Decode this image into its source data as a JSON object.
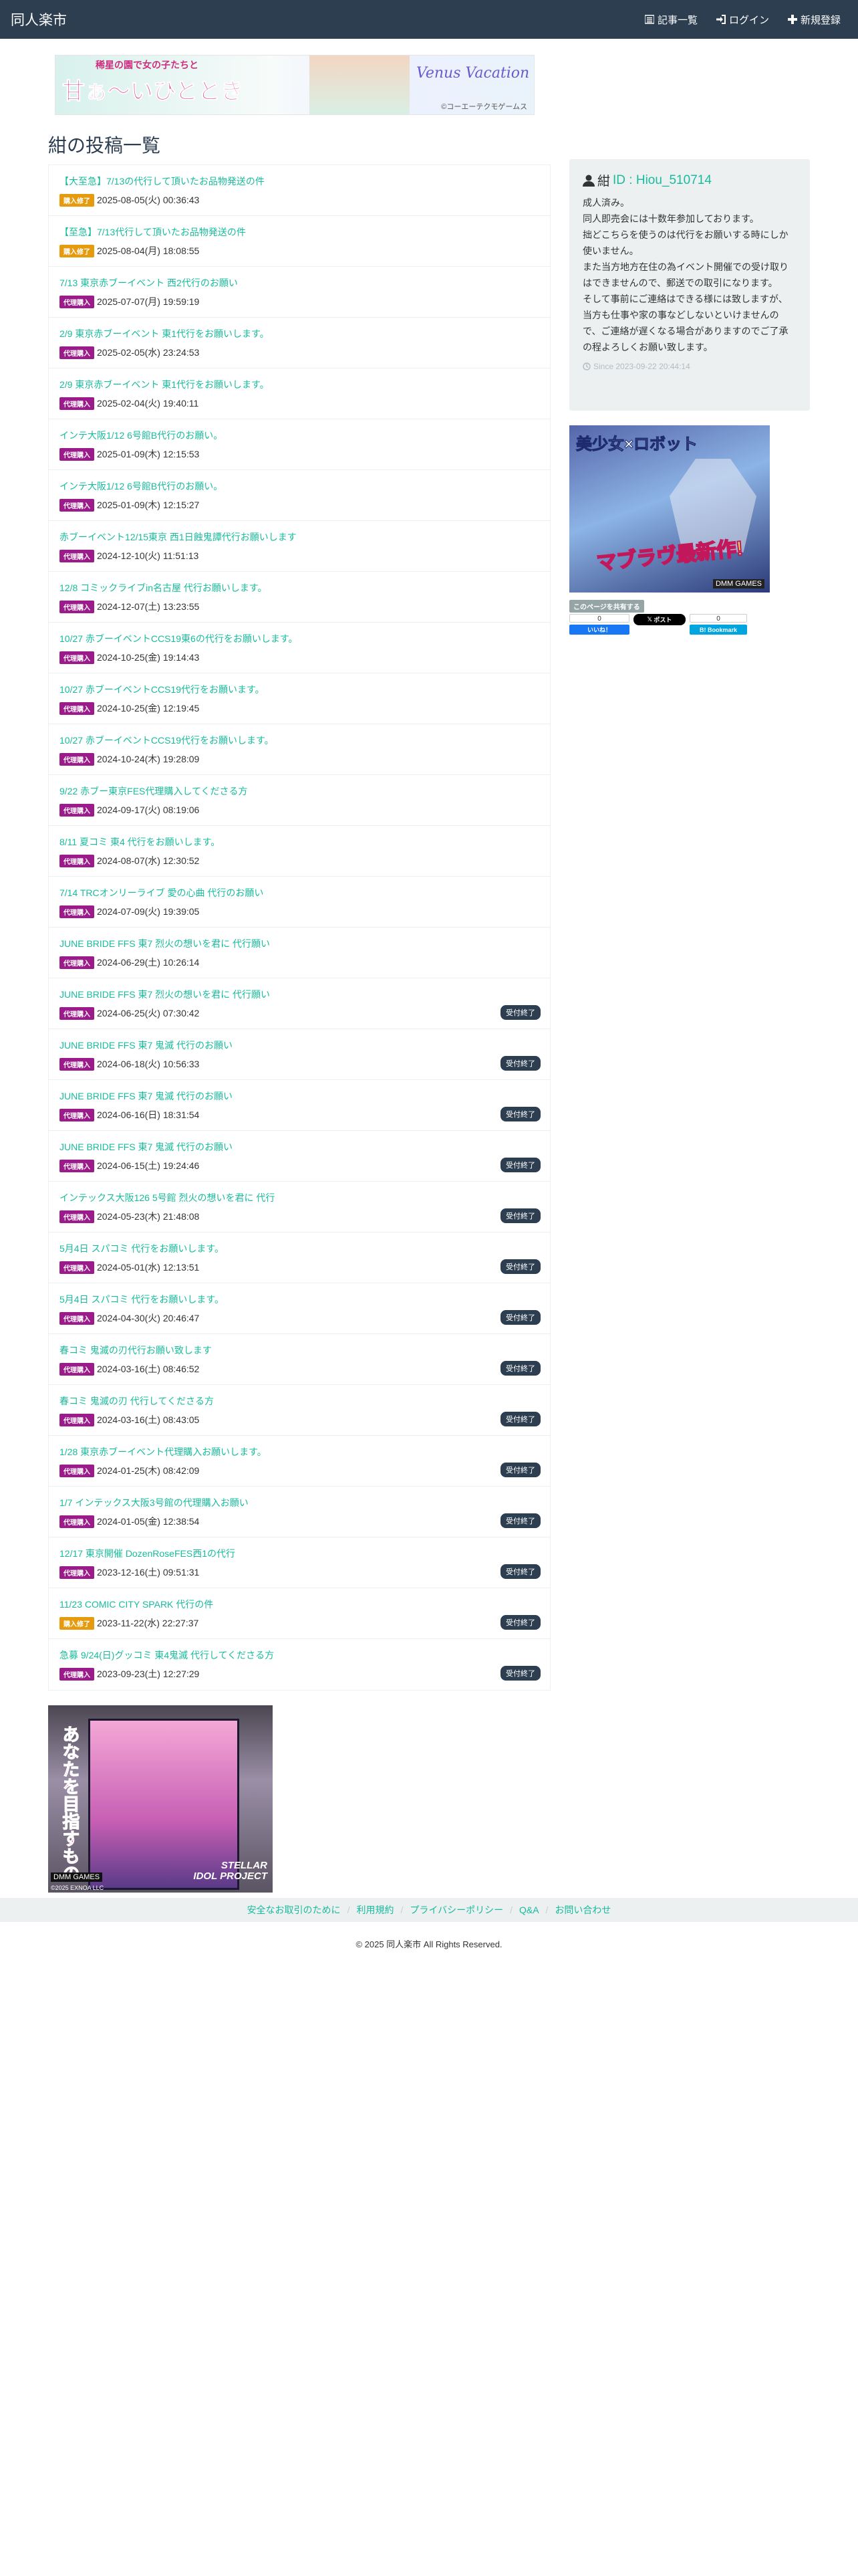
{
  "navbar": {
    "brand": "同人楽市",
    "links": [
      {
        "label": "記事一覧",
        "icon": "list-icon"
      },
      {
        "label": "ログイン",
        "icon": "login-icon"
      },
      {
        "label": "新規登録",
        "icon": "plus-icon"
      }
    ]
  },
  "top_banner": {
    "main_text": "甘ぁ～いひととき",
    "sub_text": "稀星の園で女の子たちと",
    "logo": "Venus Vacation",
    "credit": "©コーエーテクモゲームス"
  },
  "page_title": "紺の投稿一覧",
  "posts": [
    {
      "title": "【大至急】7/13の代行して頂いたお品物発送の件",
      "badge": "購入修了",
      "badge_type": "buy",
      "date": "2025-08-05(火) 00:36:43",
      "status": ""
    },
    {
      "title": "【至急】7/13代行して頂いたお品物発送の件",
      "badge": "購入修了",
      "badge_type": "buy",
      "date": "2025-08-04(月) 18:08:55",
      "status": ""
    },
    {
      "title": "7/13 東京赤ブーイベント 西2代行のお願い",
      "badge": "代理購入",
      "badge_type": "proxy",
      "date": "2025-07-07(月) 19:59:19",
      "status": ""
    },
    {
      "title": "2/9 東京赤ブーイベント 東1代行をお願いします。",
      "badge": "代理購入",
      "badge_type": "proxy",
      "date": "2025-02-05(水) 23:24:53",
      "status": ""
    },
    {
      "title": "2/9 東京赤ブーイベント 東1代行をお願いします。",
      "badge": "代理購入",
      "badge_type": "proxy",
      "date": "2025-02-04(火) 19:40:11",
      "status": ""
    },
    {
      "title": "インテ大阪1/12 6号館B代行のお願い。",
      "badge": "代理購入",
      "badge_type": "proxy",
      "date": "2025-01-09(木) 12:15:53",
      "status": ""
    },
    {
      "title": "インテ大阪1/12 6号館B代行のお願い。",
      "badge": "代理購入",
      "badge_type": "proxy",
      "date": "2025-01-09(木) 12:15:27",
      "status": ""
    },
    {
      "title": "赤ブーイベント12/15東京 西1日蝕鬼譚代行お願いします",
      "badge": "代理購入",
      "badge_type": "proxy",
      "date": "2024-12-10(火) 11:51:13",
      "status": ""
    },
    {
      "title": "12/8 コミックライブin名古屋 代行お願いします。",
      "badge": "代理購入",
      "badge_type": "proxy",
      "date": "2024-12-07(土) 13:23:55",
      "status": ""
    },
    {
      "title": "10/27 赤ブーイベントCCS19東6の代行をお願いします。",
      "badge": "代理購入",
      "badge_type": "proxy",
      "date": "2024-10-25(金) 19:14:43",
      "status": ""
    },
    {
      "title": "10/27 赤ブーイベントCCS19代行をお願います。",
      "badge": "代理購入",
      "badge_type": "proxy",
      "date": "2024-10-25(金) 12:19:45",
      "status": ""
    },
    {
      "title": "10/27 赤ブーイベントCCS19代行をお願いします。",
      "badge": "代理購入",
      "badge_type": "proxy",
      "date": "2024-10-24(木) 19:28:09",
      "status": ""
    },
    {
      "title": "9/22 赤ブー東京FES代理購入してくださる方",
      "badge": "代理購入",
      "badge_type": "proxy",
      "date": "2024-09-17(火) 08:19:06",
      "status": ""
    },
    {
      "title": "8/11 夏コミ 東4 代行をお願いします。",
      "badge": "代理購入",
      "badge_type": "proxy",
      "date": "2024-08-07(水) 12:30:52",
      "status": ""
    },
    {
      "title": "7/14 TRCオンリーライブ 愛の心曲 代行のお願い",
      "badge": "代理購入",
      "badge_type": "proxy",
      "date": "2024-07-09(火) 19:39:05",
      "status": ""
    },
    {
      "title": "JUNE BRIDE FFS 東7 烈火の想いを君に 代行願い",
      "badge": "代理購入",
      "badge_type": "proxy",
      "date": "2024-06-29(土) 10:26:14",
      "status": ""
    },
    {
      "title": "JUNE BRIDE FFS 東7 烈火の想いを君に 代行願い",
      "badge": "代理購入",
      "badge_type": "proxy",
      "date": "2024-06-25(火) 07:30:42",
      "status": "受付終了"
    },
    {
      "title": "JUNE BRIDE FFS 東7 鬼滅 代行のお願い",
      "badge": "代理購入",
      "badge_type": "proxy",
      "date": "2024-06-18(火) 10:56:33",
      "status": "受付終了"
    },
    {
      "title": "JUNE BRIDE FFS 東7 鬼滅 代行のお願い",
      "badge": "代理購入",
      "badge_type": "proxy",
      "date": "2024-06-16(日) 18:31:54",
      "status": "受付終了"
    },
    {
      "title": "JUNE BRIDE FFS 東7 鬼滅 代行のお願い",
      "badge": "代理購入",
      "badge_type": "proxy",
      "date": "2024-06-15(土) 19:24:46",
      "status": "受付終了"
    },
    {
      "title": "インテックス大阪126 5号館 烈火の想いを君に 代行",
      "badge": "代理購入",
      "badge_type": "proxy",
      "date": "2024-05-23(木) 21:48:08",
      "status": "受付終了"
    },
    {
      "title": "5月4日 スパコミ 代行をお願いします。",
      "badge": "代理購入",
      "badge_type": "proxy",
      "date": "2024-05-01(水) 12:13:51",
      "status": "受付終了"
    },
    {
      "title": "5月4日 スパコミ 代行をお願いします。",
      "badge": "代理購入",
      "badge_type": "proxy",
      "date": "2024-04-30(火) 20:46:47",
      "status": "受付終了"
    },
    {
      "title": "春コミ 鬼滅の刃代行お願い致します",
      "badge": "代理購入",
      "badge_type": "proxy",
      "date": "2024-03-16(土) 08:46:52",
      "status": "受付終了"
    },
    {
      "title": "春コミ 鬼滅の刃 代行してくださる方",
      "badge": "代理購入",
      "badge_type": "proxy",
      "date": "2024-03-16(土) 08:43:05",
      "status": "受付終了"
    },
    {
      "title": "1/28 東京赤ブーイベント代理購入お願いします。",
      "badge": "代理購入",
      "badge_type": "proxy",
      "date": "2024-01-25(木) 08:42:09",
      "status": "受付終了"
    },
    {
      "title": "1/7 インテックス大阪3号館の代理購入お願い",
      "badge": "代理購入",
      "badge_type": "proxy",
      "date": "2024-01-05(金) 12:38:54",
      "status": "受付終了"
    },
    {
      "title": "12/17 東京開催 DozenRoseFES西1の代行",
      "badge": "代理購入",
      "badge_type": "proxy",
      "date": "2023-12-16(土) 09:51:31",
      "status": "受付終了"
    },
    {
      "title": "11/23 COMIC CITY SPARK 代行の件",
      "badge": "購入修了",
      "badge_type": "buy",
      "date": "2023-11-22(水) 22:27:37",
      "status": "受付終了"
    },
    {
      "title": "急募 9/24(日)グッコミ 東4鬼滅 代行してくださる方",
      "badge": "代理購入",
      "badge_type": "proxy",
      "date": "2023-09-23(土) 12:27:29",
      "status": "受付終了"
    }
  ],
  "profile": {
    "name": "紺",
    "id": "ID : Hiou_510714",
    "bio": "成人済み。\n同人即売会には十数年参加しております。\n拙どこちらを使うのは代行をお願いする時にしか使いません。\nまた当方地方在住の為イベント開催での受け取りはできませんので、郵送での取引になります。\nそして事前にご連絡はできる様には致しますが、当方も仕事や家の事などしないといけませんので、ご連絡が遅くなる場合がありますのでご了承の程よろしくお願い致します。",
    "since": "Since 2023-09-22 20:44:14"
  },
  "side_ad": {
    "title": "美少女×ロボット",
    "slogan": "マブラヴ最新作!",
    "maker": "DMM GAMES"
  },
  "share": {
    "label": "このページを共有する",
    "fb_count": "0",
    "fb_label": "いいね！",
    "x_label": "ポスト",
    "hatena_count": "0",
    "hatena_label": "Bookmark"
  },
  "bottom_ad": {
    "vertical_text": "あなたを目指すもの",
    "brand_line1": "STELLAR",
    "brand_line2": "IDOL PROJECT",
    "maker": "DMM GAMES",
    "copyright": "©2025 EXNOA LLC"
  },
  "footer": {
    "links": [
      "安全なお取引のために",
      "利用規約",
      "プライバシーポリシー",
      "Q&A",
      "お問い合わせ"
    ],
    "copyright": "© 2025 同人楽市 All Rights Reserved."
  },
  "colors": {
    "navbar": "#2c3e50",
    "link": "#18bc9c",
    "badge_proxy": "#9b1b8a",
    "badge_buy": "#e69b0f",
    "status": "#2c3e50",
    "sidebar_bg": "#ecf0f1"
  }
}
